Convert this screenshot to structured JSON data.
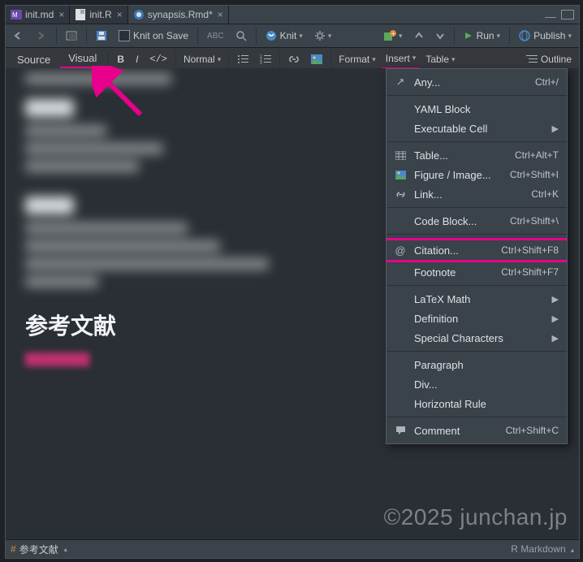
{
  "tabs": [
    {
      "label": "init.md",
      "icon": "md"
    },
    {
      "label": "init.R",
      "icon": "r"
    },
    {
      "label": "synapsis.Rmd*",
      "icon": "rmd",
      "active": true
    }
  ],
  "toolbar": {
    "knit_on_save": "Knit on Save",
    "knit": "Knit",
    "run": "Run",
    "publish": "Publish"
  },
  "toolbar2": {
    "source": "Source",
    "visual": "Visual",
    "normal": "Normal",
    "format": "Format",
    "insert": "Insert",
    "table": "Table",
    "outline": "Outline"
  },
  "menu": {
    "any": {
      "label": "Any...",
      "shortcut": "Ctrl+/"
    },
    "yaml": {
      "label": "YAML Block"
    },
    "exec": {
      "label": "Executable Cell"
    },
    "table": {
      "label": "Table...",
      "shortcut": "Ctrl+Alt+T"
    },
    "figure": {
      "label": "Figure / Image...",
      "shortcut": "Ctrl+Shift+I"
    },
    "link": {
      "label": "Link...",
      "shortcut": "Ctrl+K"
    },
    "code": {
      "label": "Code Block...",
      "shortcut": "Ctrl+Shift+\\"
    },
    "citation": {
      "label": "Citation...",
      "shortcut": "Ctrl+Shift+F8"
    },
    "footnote": {
      "label": "Footnote",
      "shortcut": "Ctrl+Shift+F7"
    },
    "latex": {
      "label": "LaTeX Math"
    },
    "definition": {
      "label": "Definition"
    },
    "special": {
      "label": "Special Characters"
    },
    "paragraph": {
      "label": "Paragraph"
    },
    "div": {
      "label": "Div..."
    },
    "hr": {
      "label": "Horizontal Rule"
    },
    "comment": {
      "label": "Comment",
      "shortcut": "Ctrl+Shift+C"
    }
  },
  "content": {
    "heading": "参考文献"
  },
  "bottom": {
    "crumb": "参考文献",
    "mode": "R Markdown"
  },
  "watermark": "©2025 junchan.jp"
}
